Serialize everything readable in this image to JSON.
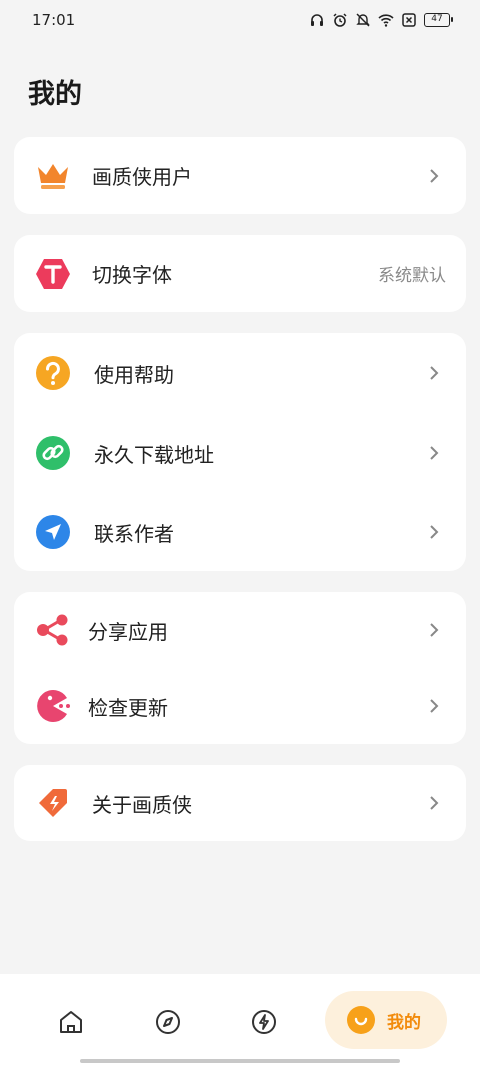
{
  "status": {
    "time": "17:01",
    "battery": "47",
    "icons": [
      "headphones-icon",
      "alarm-icon",
      "mute-icon",
      "wifi-icon",
      "sim-off-icon",
      "battery-icon"
    ]
  },
  "page": {
    "title": "我的"
  },
  "sections": [
    {
      "items": [
        {
          "label": "画质侠用户",
          "icon": "crown-icon",
          "color": "#f2852c"
        }
      ]
    },
    {
      "items": [
        {
          "label": "切换字体",
          "icon": "font-icon",
          "color": "#ec3b5c",
          "value": "系统默认"
        }
      ]
    },
    {
      "items": [
        {
          "label": "使用帮助",
          "icon": "question-icon",
          "color": "#f6a623"
        },
        {
          "label": "永久下载地址",
          "icon": "link-icon",
          "color": "#2fbf6a"
        },
        {
          "label": "联系作者",
          "icon": "send-icon",
          "color": "#2d86e8"
        }
      ]
    },
    {
      "items": [
        {
          "label": "分享应用",
          "icon": "share-icon",
          "color": "#e94a5c"
        },
        {
          "label": "检查更新",
          "icon": "pacman-icon",
          "color": "#e8456f"
        }
      ]
    },
    {
      "items": [
        {
          "label": "关于画质侠",
          "icon": "tag-icon",
          "color": "#f06a3a"
        }
      ]
    }
  ],
  "tabbar": {
    "tabs": [
      {
        "name": "home",
        "icon": "home-icon"
      },
      {
        "name": "discover",
        "icon": "compass-icon"
      },
      {
        "name": "boost",
        "icon": "lightning-icon"
      }
    ],
    "active": {
      "label": "我的",
      "icon": "smile-icon",
      "color": "#f7a11a"
    }
  }
}
